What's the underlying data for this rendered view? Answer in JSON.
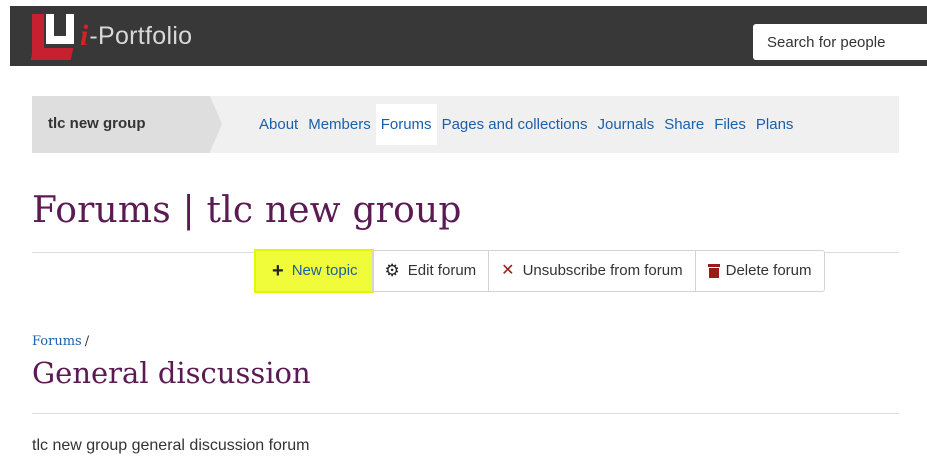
{
  "header": {
    "logo_i": "i",
    "logo_text": "-Portfolio",
    "search_placeholder": "Search for people"
  },
  "groupnav": {
    "group_name": "tlc new group",
    "tabs": [
      {
        "label": "About",
        "active": false
      },
      {
        "label": "Members",
        "active": false
      },
      {
        "label": "Forums",
        "active": true
      },
      {
        "label": "Pages and collections",
        "active": false
      },
      {
        "label": "Journals",
        "active": false
      },
      {
        "label": "Share",
        "active": false
      },
      {
        "label": "Files",
        "active": false
      },
      {
        "label": "Plans",
        "active": false
      }
    ]
  },
  "page": {
    "title": "Forums | tlc new group",
    "breadcrumb_link": "Forums",
    "breadcrumb_sep": "/",
    "section_title": "General discussion",
    "description": "tlc new group general discussion forum"
  },
  "actions": {
    "new_topic": "New topic",
    "edit_forum": "Edit forum",
    "unsubscribe": "Unsubscribe from forum",
    "delete_forum": "Delete forum",
    "highlight_color": "#f0fb39"
  }
}
